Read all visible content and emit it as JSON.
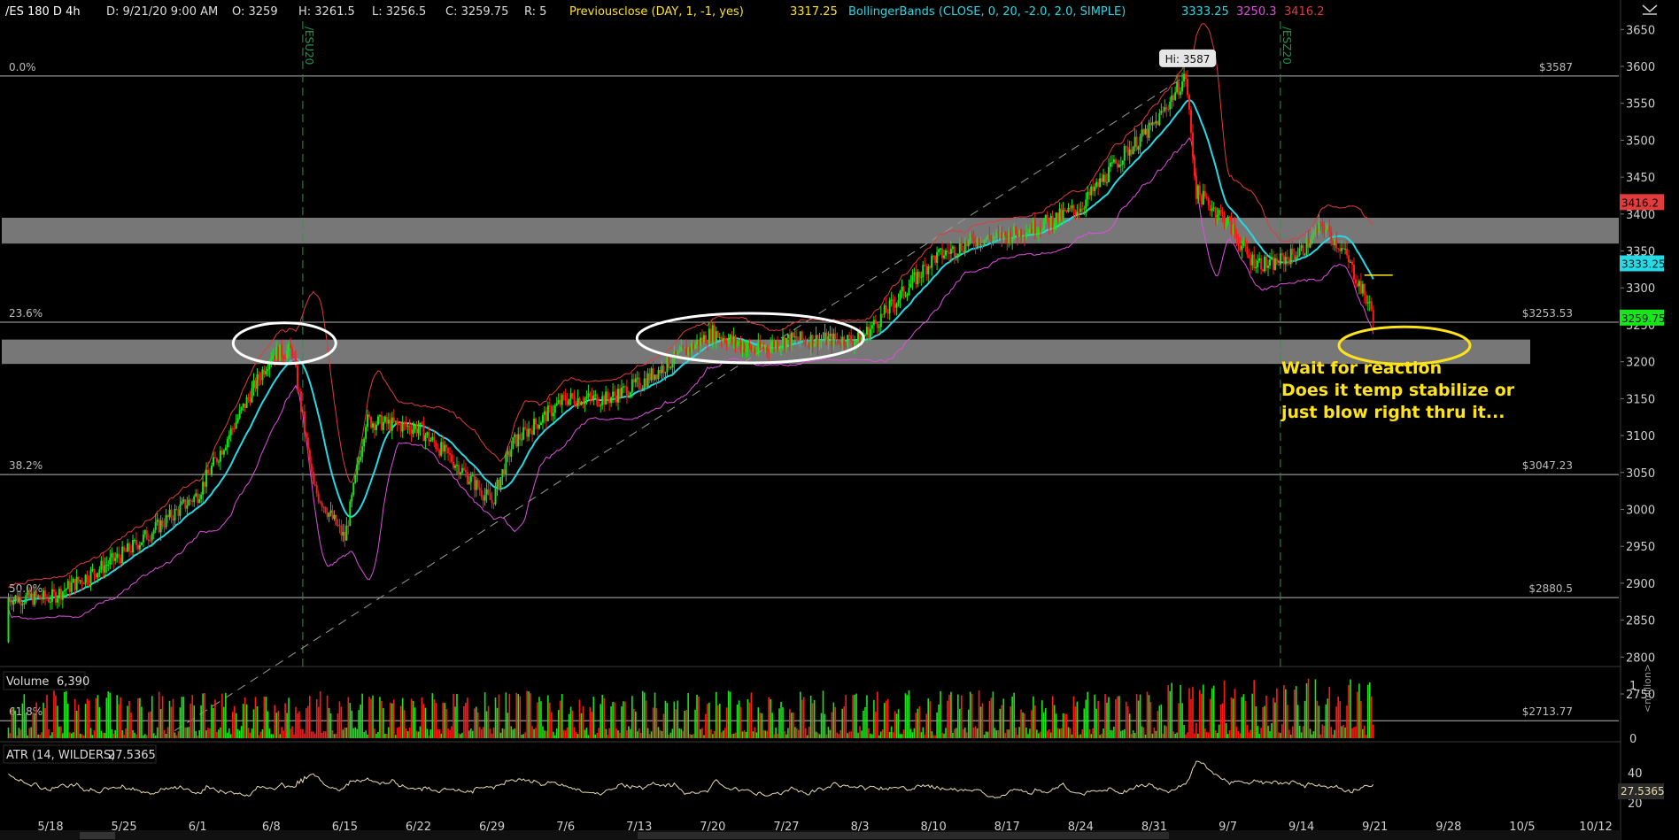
{
  "header": {
    "symbol": "/ES 180 D 4h",
    "datetime": "D: 9/21/20 9:00 AM",
    "open": "O: 3259",
    "high": "H: 3261.5",
    "low": "L: 3256.5",
    "close": "C: 3259.75",
    "range": "R: 5",
    "prevclose_label": "Previousclose (DAY, 1, -1, yes)",
    "prevclose_value": "3317.25",
    "bb_label": "BollingerBands (CLOSE, 0, 20, -2.0, 2.0, SIMPLE)",
    "bb_mid": "3333.25",
    "bb_lower": "3250.3",
    "bb_upper": "3416.2"
  },
  "colors": {
    "up": "#19e61a",
    "down": "#ff1a1a",
    "bb_mid": "#26d9e6",
    "bb_lower": "#e04ee0",
    "bb_upper": "#e23b3b",
    "annotation": "#ffe31a",
    "zone": "#8c8c8c"
  },
  "contract_markers": [
    "/ESU20",
    "/ESZ20"
  ],
  "volume_panel": {
    "label": "Volume",
    "value": "6,390",
    "axis_label": "<million>",
    "ticks": [
      {
        "v": 1,
        "t": "1"
      },
      {
        "v": 0,
        "t": "0"
      }
    ]
  },
  "atr_panel": {
    "label": "ATR (14, WILDERS)",
    "value": "27.5365",
    "ticks": [
      {
        "v": 40,
        "t": "40"
      },
      {
        "v": 20,
        "t": "20"
      }
    ]
  },
  "chart_data": {
    "type": "candlestick",
    "price_axis": {
      "min": 2700,
      "max": 3670,
      "ticks": [
        2750,
        2800,
        2850,
        2900,
        2950,
        3000,
        3050,
        3100,
        3150,
        3200,
        3250,
        3300,
        3350,
        3400,
        3450,
        3500,
        3550,
        3600,
        3650
      ]
    },
    "x_axis": {
      "ticks": [
        "5/18",
        "5/25",
        "6/1",
        "6/8",
        "6/15",
        "6/22",
        "6/29",
        "7/6",
        "7/13",
        "7/20",
        "7/27",
        "8/3",
        "8/10",
        "8/17",
        "8/24",
        "8/31",
        "9/7",
        "9/14",
        "9/21",
        "9/28",
        "10/5",
        "10/12"
      ]
    },
    "price_path": [
      [
        "5/18",
        2880
      ],
      [
        "5/25",
        2940
      ],
      [
        "6/1",
        3020
      ],
      [
        "6/8",
        3210
      ],
      [
        "6/10",
        3215
      ],
      [
        "6/12",
        3030
      ],
      [
        "6/15",
        2960
      ],
      [
        "6/17",
        3120
      ],
      [
        "6/22",
        3110
      ],
      [
        "6/25",
        3070
      ],
      [
        "6/29",
        3010
      ],
      [
        "7/1",
        3090
      ],
      [
        "7/6",
        3150
      ],
      [
        "7/10",
        3150
      ],
      [
        "7/13",
        3170
      ],
      [
        "7/16",
        3200
      ],
      [
        "7/20",
        3240
      ],
      [
        "7/24",
        3215
      ],
      [
        "7/27",
        3230
      ],
      [
        "8/3",
        3230
      ],
      [
        "8/5",
        3260
      ],
      [
        "8/10",
        3340
      ],
      [
        "8/14",
        3365
      ],
      [
        "8/17",
        3370
      ],
      [
        "8/21",
        3390
      ],
      [
        "8/24",
        3410
      ],
      [
        "8/28",
        3480
      ],
      [
        "8/31",
        3520
      ],
      [
        "9/3",
        3587
      ],
      [
        "9/4",
        3430
      ],
      [
        "9/7",
        3390
      ],
      [
        "9/9",
        3340
      ],
      [
        "9/11",
        3330
      ],
      [
        "9/14",
        3350
      ],
      [
        "9/16",
        3385
      ],
      [
        "9/18",
        3350
      ],
      [
        "9/21",
        3259.75
      ]
    ],
    "bollinger": {
      "mid_last": 3333.25,
      "lower_last": 3250.3,
      "upper_last": 3416.2,
      "prev_close": 3317.25
    },
    "fibonacci": [
      {
        "level": "0.0%",
        "price": 3587,
        "price_label": "$3587"
      },
      {
        "level": "23.6%",
        "price": 3253.53,
        "price_label": "$3253.53"
      },
      {
        "level": "38.2%",
        "price": 3047.23,
        "price_label": "$3047.23"
      },
      {
        "level": "50.0%",
        "price": 2880.5,
        "price_label": "$2880.5"
      },
      {
        "level": "61.8%",
        "price": 2713.77,
        "price_label": "$2713.77"
      }
    ],
    "zones": [
      {
        "from": 3360,
        "to": 3395
      },
      {
        "from": 3197,
        "to": 3230
      }
    ],
    "hi_label": "Hi: 3587",
    "last_price_labels": [
      {
        "text": "3416.2",
        "price": 3416.2,
        "color": "#e23b3b"
      },
      {
        "text": "3333.25",
        "price": 3333.25,
        "color": "#26d9e6"
      },
      {
        "text": "3259.75",
        "price": 3259.75,
        "color": "#19e61a"
      }
    ],
    "annotation_lines": [
      "Wait for reaction",
      "Does it temp stabilize or",
      "just blow right thru it..."
    ]
  }
}
